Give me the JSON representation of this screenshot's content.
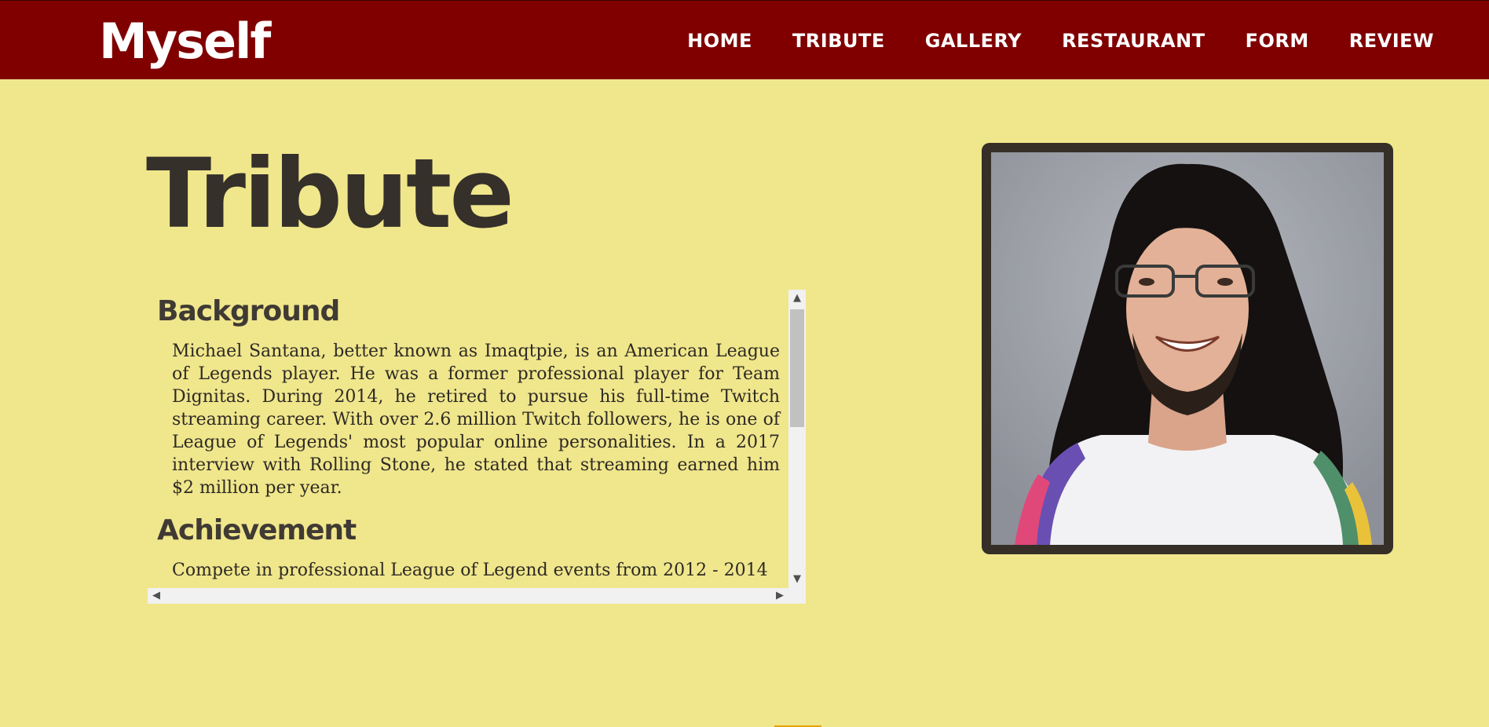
{
  "site": {
    "logo": "Myself"
  },
  "nav": {
    "items": [
      {
        "label": "HOME"
      },
      {
        "label": "TRIBUTE"
      },
      {
        "label": "GALLERY"
      },
      {
        "label": "RESTAURANT"
      },
      {
        "label": "FORM"
      },
      {
        "label": "REVIEW"
      }
    ]
  },
  "page": {
    "title": "Tribute"
  },
  "content": {
    "background": {
      "heading": "Background",
      "text": "Michael Santana, better known as Imaqtpie, is an American League of Legends player. He was a former professional player for Team Dignitas. During 2014, he retired to pursue his full-time Twitch streaming career. With over 2.6 million Twitch followers, he is one of League of Legends' most popular online personalities. In a 2017 interview with Rolling Stone, he stated that streaming earned him $2 million per year."
    },
    "achievement": {
      "heading": "Achievement",
      "text": "Compete in professional League of Legend events from 2012 - 2014"
    }
  },
  "colors": {
    "header": "#800000",
    "page_background": "#f0e68c",
    "title": "#35302a",
    "frame": "#352f27"
  }
}
